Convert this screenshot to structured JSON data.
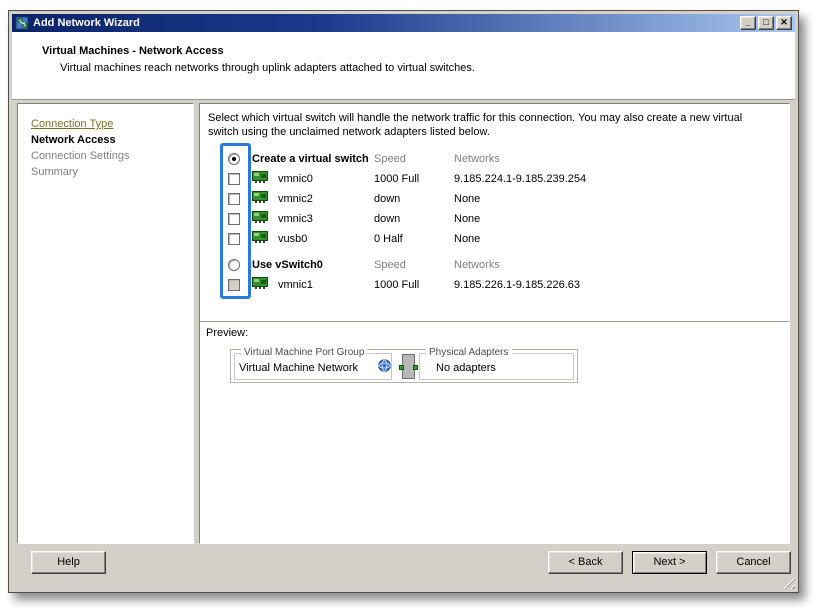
{
  "window": {
    "title": "Add Network Wizard",
    "buttons": {
      "minimize": "_",
      "maximize": "□",
      "close": "✕"
    }
  },
  "header": {
    "title": "Virtual Machines - Network Access",
    "subtitle": "Virtual machines reach networks through uplink adapters attached to virtual switches."
  },
  "sidebar": {
    "items": [
      {
        "label": "Connection Type",
        "state": "link"
      },
      {
        "label": "Network Access",
        "state": "current"
      },
      {
        "label": "Connection Settings",
        "state": "disabled"
      },
      {
        "label": "Summary",
        "state": "disabled"
      }
    ]
  },
  "content": {
    "instruction": "Select which virtual switch will handle the network traffic for this connection. You may also create a new virtual switch using the unclaimed network adapters listed below.",
    "columns": {
      "speed": "Speed",
      "networks": "Networks"
    },
    "groups": [
      {
        "label": "Create a virtual switch",
        "selected": true,
        "adapters": [
          {
            "name": "vmnic0",
            "speed": "1000 Full",
            "networks": "9.185.224.1-9.185.239.254",
            "checked": false,
            "enabled": true
          },
          {
            "name": "vmnic2",
            "speed": "down",
            "networks": "None",
            "checked": false,
            "enabled": true
          },
          {
            "name": "vmnic3",
            "speed": "down",
            "networks": "None",
            "checked": false,
            "enabled": true
          },
          {
            "name": "vusb0",
            "speed": "0 Half",
            "networks": "None",
            "checked": false,
            "enabled": true
          }
        ]
      },
      {
        "label": "Use vSwitch0",
        "selected": false,
        "adapters": [
          {
            "name": "vmnic1",
            "speed": "1000 Full",
            "networks": "9.185.226.1-9.185.226.63",
            "checked": false,
            "enabled": false
          }
        ]
      }
    ],
    "preview": {
      "label": "Preview:",
      "port_group_title": "Virtual Machine Port Group",
      "port_group_name": "Virtual Machine Network",
      "physical_title": "Physical Adapters",
      "physical_value": "No adapters"
    }
  },
  "footer": {
    "help": "Help",
    "back": "< Back",
    "next": "Next >",
    "cancel": "Cancel"
  },
  "colors": {
    "titlebar_left": "#0a246a",
    "titlebar_right": "#a8c7f0",
    "chrome": "#d4d0c8",
    "annotation_highlight": "#2a7ade",
    "sidebar_link": "#73732d",
    "muted_text": "#808080"
  }
}
